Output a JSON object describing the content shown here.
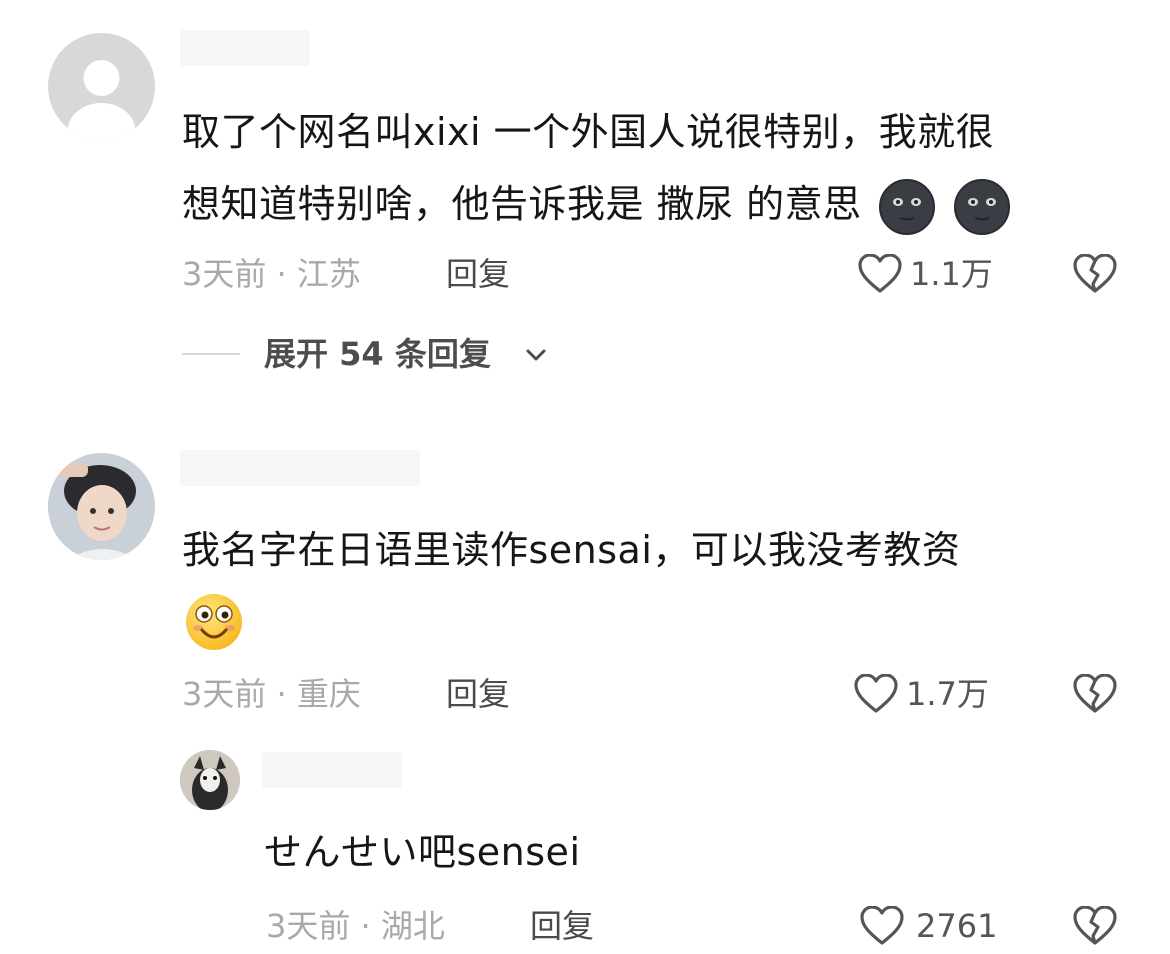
{
  "comments": [
    {
      "text_line1": "取了个网名叫xixi 一个外国人说很特别，我就很",
      "text_line2": "想知道特别啥，他告诉我是 撒尿 的意思",
      "emojis": [
        "dark-moon-face-emoji",
        "dark-moon-face-emoji"
      ],
      "meta": "3天前 · 江苏",
      "reply_label": "回复",
      "likes": "1.1万",
      "expand_label": "展开 54 条回复"
    },
    {
      "text_line1": "我名字在日语里读作sensai，可以我没考教资",
      "emoji": "grinning-face-emoji",
      "meta": "3天前 · 重庆",
      "reply_label": "回复",
      "likes": "1.7万"
    }
  ],
  "replies": [
    {
      "text": "せんせい吧sensei",
      "meta": "3天前 · 湖北",
      "reply_label": "回复",
      "likes": "2761"
    }
  ],
  "colors": {
    "meta": "#a9a9a9",
    "text": "#161616",
    "icon": "#555555"
  },
  "icons": [
    "heart-outline-icon",
    "broken-heart-icon",
    "chevron-down-icon"
  ]
}
